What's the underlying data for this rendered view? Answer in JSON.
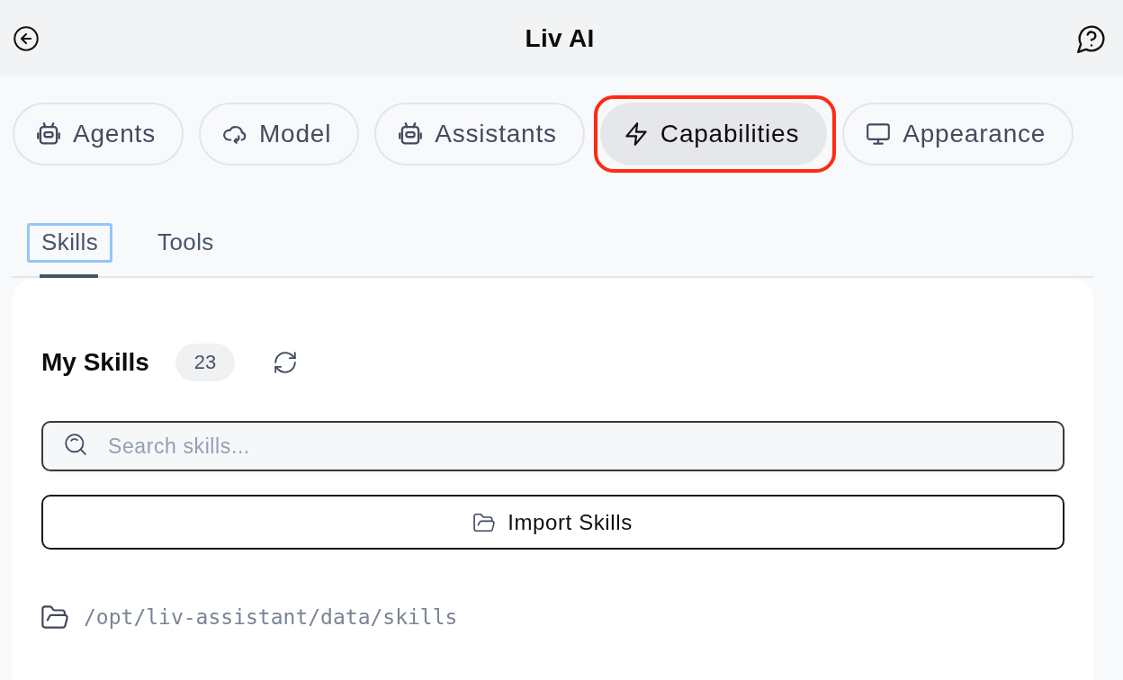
{
  "header": {
    "title": "Liv AI"
  },
  "categories": [
    {
      "label": "Agents",
      "kind": "robot",
      "selected": false,
      "highlighted": false
    },
    {
      "label": "Model",
      "kind": "cloud",
      "selected": false,
      "highlighted": false
    },
    {
      "label": "Assistants",
      "kind": "robot",
      "selected": false,
      "highlighted": false
    },
    {
      "label": "Capabilities",
      "kind": "bolt",
      "selected": true,
      "highlighted": true
    },
    {
      "label": "Appearance",
      "kind": "monitor",
      "selected": false,
      "highlighted": false
    }
  ],
  "subtabs": [
    {
      "label": "Skills",
      "selected": true,
      "focused": true
    },
    {
      "label": "Tools",
      "selected": false,
      "focused": false
    }
  ],
  "skills_panel": {
    "title": "My Skills",
    "count": "23",
    "search": {
      "placeholder": "Search skills..."
    },
    "import_button": "Import Skills",
    "path": "/opt/liv-assistant/data/skills"
  }
}
